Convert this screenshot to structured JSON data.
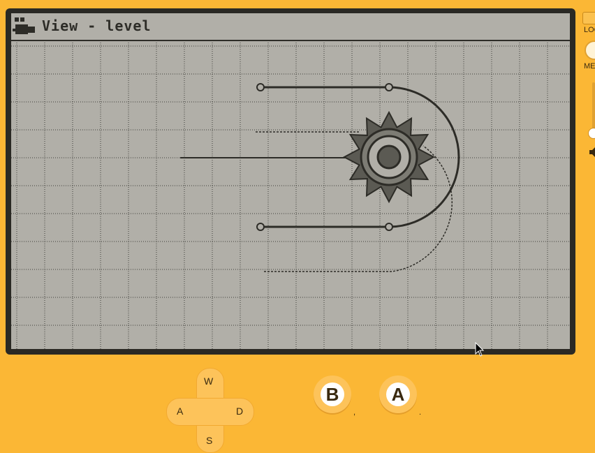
{
  "window": {
    "title": "View - level"
  },
  "side_panel": {
    "lock_label": "LOC",
    "menu_label": "MEN",
    "volume_level": 1.0
  },
  "controls": {
    "dpad": {
      "up": "W",
      "left": "A",
      "right": "D",
      "down": "S"
    },
    "b_button": {
      "label": "B",
      "key_hint": ","
    },
    "a_button": {
      "label": "A",
      "key_hint": "."
    }
  },
  "icons": {
    "title": "camera-icon",
    "sawblade": "sawblade-icon",
    "speaker": "speaker-icon",
    "cursor": "mouse-cursor-icon"
  },
  "colors": {
    "body": "#fbb735",
    "bezel": "#2a2924",
    "screen": "#b1afa8",
    "ink": "#2d2c27"
  }
}
